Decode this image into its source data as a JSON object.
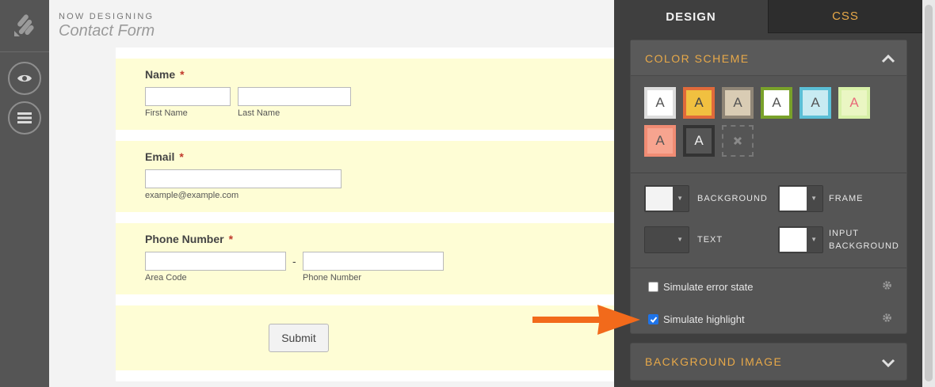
{
  "header": {
    "label": "NOW DESIGNING",
    "title": "Contact Form"
  },
  "form": {
    "name": {
      "label": "Name",
      "required": "*",
      "first_sub": "First Name",
      "last_sub": "Last Name"
    },
    "email": {
      "label": "Email",
      "required": "*",
      "sub": "example@example.com"
    },
    "phone": {
      "label": "Phone Number",
      "required": "*",
      "dash": "-",
      "area_sub": "Area Code",
      "number_sub": "Phone Number"
    },
    "submit_label": "Submit"
  },
  "panel": {
    "tabs": {
      "design": "DESIGN",
      "css": "CSS"
    },
    "color_scheme": {
      "title": "COLOR SCHEME",
      "swatches": [
        {
          "letter": "A",
          "bg": "#ffffff",
          "border": "#dddddd",
          "text": "#555555"
        },
        {
          "letter": "A",
          "bg": "#f1c040",
          "border": "#e06a3a",
          "text": "#444444"
        },
        {
          "letter": "A",
          "bg": "#d9ccb4",
          "border": "#8f8576",
          "text": "#555555"
        },
        {
          "letter": "A",
          "bg": "#ffffff",
          "border": "#79a12a",
          "text": "#555555"
        },
        {
          "letter": "A",
          "bg": "#c8ebf2",
          "border": "#5bbfd6",
          "text": "#555555"
        },
        {
          "letter": "A",
          "bg": "#eaf6c3",
          "border": "#d7f0a8",
          "text": "#e86a7a"
        },
        {
          "letter": "A",
          "bg": "#f7a48f",
          "border": "#f08c74",
          "text": "#555555"
        },
        {
          "letter": "A",
          "bg": "#555555",
          "border": "#333333",
          "text": "#eeeeee"
        }
      ],
      "remove_icon": "x-icon",
      "pickers": {
        "background": {
          "label": "BACKGROUND",
          "color": "#f3f3f3"
        },
        "frame": {
          "label": "FRAME",
          "color": "#ffffff"
        },
        "text": {
          "label": "TEXT",
          "color": "#484848"
        },
        "input_background": {
          "label": "INPUT BACKGROUND",
          "color": "#ffffff"
        }
      },
      "simulate_error": {
        "label": "Simulate error state",
        "checked": false
      },
      "simulate_highlight": {
        "label": "Simulate highlight",
        "checked": true
      }
    },
    "background_image": {
      "title": "BACKGROUND IMAGE"
    }
  },
  "colors": {
    "accent": "#e8a949",
    "arrow": "#f26a1b",
    "highlight_field": "#fefdd5"
  }
}
